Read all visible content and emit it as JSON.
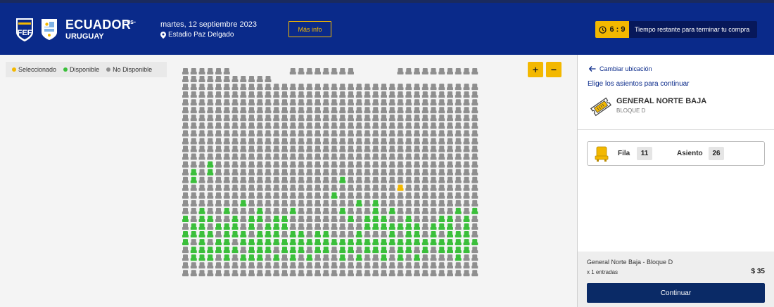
{
  "header": {
    "home_team": "ECUADOR",
    "vs": "-vs-",
    "away_team": "URUGUAY",
    "date": "martes, 12 septiembre 2023",
    "venue": "Estadio Paz Delgado",
    "more_info": "Más info",
    "timer": "6 : 9",
    "timer_label": "Tiempo restante para terminar tu compra"
  },
  "legend": {
    "selected": "Seleccionado",
    "available": "Disponible",
    "unavailable": "No Disponible"
  },
  "zoom": {
    "in": "+",
    "out": "−"
  },
  "panel": {
    "back_link": "Cambiar ubicación",
    "instruction": "Elige los asientos para continuar",
    "zone_name": "GENERAL NORTE BAJA",
    "zone_block": "BLOQUE D",
    "row_label": "Fila",
    "row_value": "11",
    "seat_label": "Asiento",
    "seat_value": "26",
    "summary_title": "General Norte Baja - Bloque D",
    "summary_qty": "x 1 entradas",
    "summary_price": "$ 35",
    "continue": "Continuar"
  },
  "colors": {
    "header_bg": "#0a2a8a",
    "accent": "#f3b800",
    "available": "#3bbf3b",
    "unavailable": "#8f8f8f",
    "selected": "#f3b800",
    "button_bg": "#0a2a66"
  },
  "seatmap": {
    "rows": 27,
    "cols": 36,
    "selected": [
      [
        15,
        26
      ]
    ],
    "available": [
      [
        12,
        3
      ],
      [
        13,
        1
      ],
      [
        13,
        3
      ],
      [
        14,
        1
      ],
      [
        14,
        19
      ],
      [
        16,
        18
      ],
      [
        17,
        7
      ],
      [
        17,
        21
      ],
      [
        17,
        23
      ],
      [
        18,
        2
      ],
      [
        18,
        5
      ],
      [
        18,
        9
      ],
      [
        18,
        13
      ],
      [
        18,
        19
      ],
      [
        18,
        23
      ],
      [
        18,
        25
      ],
      [
        18,
        33
      ],
      [
        18,
        35
      ],
      [
        19,
        0
      ],
      [
        19,
        2
      ],
      [
        19,
        3
      ],
      [
        19,
        6
      ],
      [
        19,
        8
      ],
      [
        19,
        9
      ],
      [
        19,
        11
      ],
      [
        19,
        12
      ],
      [
        19,
        20
      ],
      [
        19,
        22
      ],
      [
        19,
        23
      ],
      [
        19,
        24
      ],
      [
        19,
        27
      ],
      [
        19,
        31
      ],
      [
        19,
        32
      ],
      [
        19,
        34
      ],
      [
        20,
        1
      ],
      [
        20,
        2
      ],
      [
        20,
        4
      ],
      [
        20,
        5
      ],
      [
        20,
        6
      ],
      [
        20,
        8
      ],
      [
        20,
        10
      ],
      [
        20,
        11
      ],
      [
        20,
        12
      ],
      [
        20,
        22
      ],
      [
        20,
        23
      ],
      [
        20,
        24
      ],
      [
        20,
        25
      ],
      [
        20,
        26
      ],
      [
        20,
        27
      ],
      [
        20,
        28
      ],
      [
        20,
        30
      ],
      [
        20,
        31
      ],
      [
        20,
        32
      ],
      [
        20,
        34
      ],
      [
        21,
        0
      ],
      [
        21,
        1
      ],
      [
        21,
        2
      ],
      [
        21,
        3
      ],
      [
        21,
        5
      ],
      [
        21,
        6
      ],
      [
        21,
        7
      ],
      [
        21,
        9
      ],
      [
        21,
        10
      ],
      [
        21,
        11
      ],
      [
        21,
        13
      ],
      [
        21,
        14
      ],
      [
        21,
        16
      ],
      [
        21,
        17
      ],
      [
        21,
        21
      ],
      [
        21,
        25
      ],
      [
        21,
        27
      ],
      [
        21,
        28
      ],
      [
        21,
        30
      ],
      [
        21,
        32
      ],
      [
        21,
        33
      ],
      [
        21,
        34
      ],
      [
        22,
        0
      ],
      [
        22,
        2
      ],
      [
        22,
        4
      ],
      [
        22,
        5
      ],
      [
        22,
        7
      ],
      [
        22,
        8
      ],
      [
        22,
        9
      ],
      [
        22,
        10
      ],
      [
        22,
        11
      ],
      [
        22,
        12
      ],
      [
        22,
        13
      ],
      [
        22,
        14
      ],
      [
        22,
        15
      ],
      [
        22,
        16
      ],
      [
        22,
        17
      ],
      [
        22,
        18
      ],
      [
        22,
        19
      ],
      [
        22,
        20
      ],
      [
        22,
        21
      ],
      [
        22,
        22
      ],
      [
        22,
        23
      ],
      [
        22,
        24
      ],
      [
        22,
        25
      ],
      [
        22,
        26
      ],
      [
        22,
        27
      ],
      [
        22,
        28
      ],
      [
        22,
        29
      ],
      [
        22,
        30
      ],
      [
        22,
        31
      ],
      [
        22,
        32
      ],
      [
        22,
        33
      ],
      [
        22,
        34
      ],
      [
        22,
        35
      ],
      [
        23,
        1
      ],
      [
        23,
        2
      ],
      [
        23,
        3
      ],
      [
        23,
        4
      ],
      [
        23,
        5
      ],
      [
        23,
        6
      ],
      [
        23,
        8
      ],
      [
        23,
        9
      ],
      [
        23,
        10
      ],
      [
        23,
        12
      ],
      [
        23,
        13
      ],
      [
        23,
        14
      ],
      [
        23,
        16
      ],
      [
        23,
        17
      ],
      [
        23,
        19
      ],
      [
        23,
        20
      ],
      [
        23,
        22
      ],
      [
        23,
        23
      ],
      [
        23,
        24
      ],
      [
        23,
        26
      ],
      [
        23,
        27
      ],
      [
        23,
        29
      ],
      [
        23,
        31
      ],
      [
        23,
        32
      ],
      [
        23,
        33
      ],
      [
        23,
        34
      ],
      [
        24,
        1
      ],
      [
        24,
        2
      ],
      [
        24,
        3
      ],
      [
        24,
        5
      ],
      [
        24,
        7
      ],
      [
        24,
        8
      ],
      [
        24,
        9
      ],
      [
        24,
        11
      ],
      [
        24,
        13
      ],
      [
        24,
        15
      ],
      [
        24,
        19
      ],
      [
        24,
        21
      ],
      [
        24,
        24
      ],
      [
        24,
        26
      ],
      [
        24,
        28
      ],
      [
        24,
        33
      ]
    ],
    "hidden": [
      [
        0,
        6
      ],
      [
        0,
        7
      ],
      [
        0,
        8
      ],
      [
        0,
        9
      ],
      [
        0,
        10
      ],
      [
        0,
        11
      ],
      [
        0,
        12
      ],
      [
        0,
        21
      ],
      [
        0,
        22
      ],
      [
        0,
        23
      ],
      [
        0,
        24
      ],
      [
        0,
        25
      ],
      [
        1,
        11
      ],
      [
        1,
        12
      ],
      [
        1,
        13
      ],
      [
        1,
        14
      ],
      [
        1,
        15
      ],
      [
        1,
        16
      ],
      [
        1,
        17
      ],
      [
        1,
        18
      ],
      [
        1,
        19
      ],
      [
        1,
        20
      ],
      [
        1,
        21
      ],
      [
        1,
        22
      ],
      [
        1,
        23
      ],
      [
        1,
        24
      ],
      [
        1,
        25
      ],
      [
        1,
        26
      ],
      [
        1,
        27
      ],
      [
        1,
        28
      ],
      [
        1,
        29
      ],
      [
        1,
        30
      ],
      [
        1,
        31
      ],
      [
        1,
        32
      ],
      [
        1,
        33
      ],
      [
        1,
        34
      ],
      [
        1,
        35
      ]
    ]
  }
}
